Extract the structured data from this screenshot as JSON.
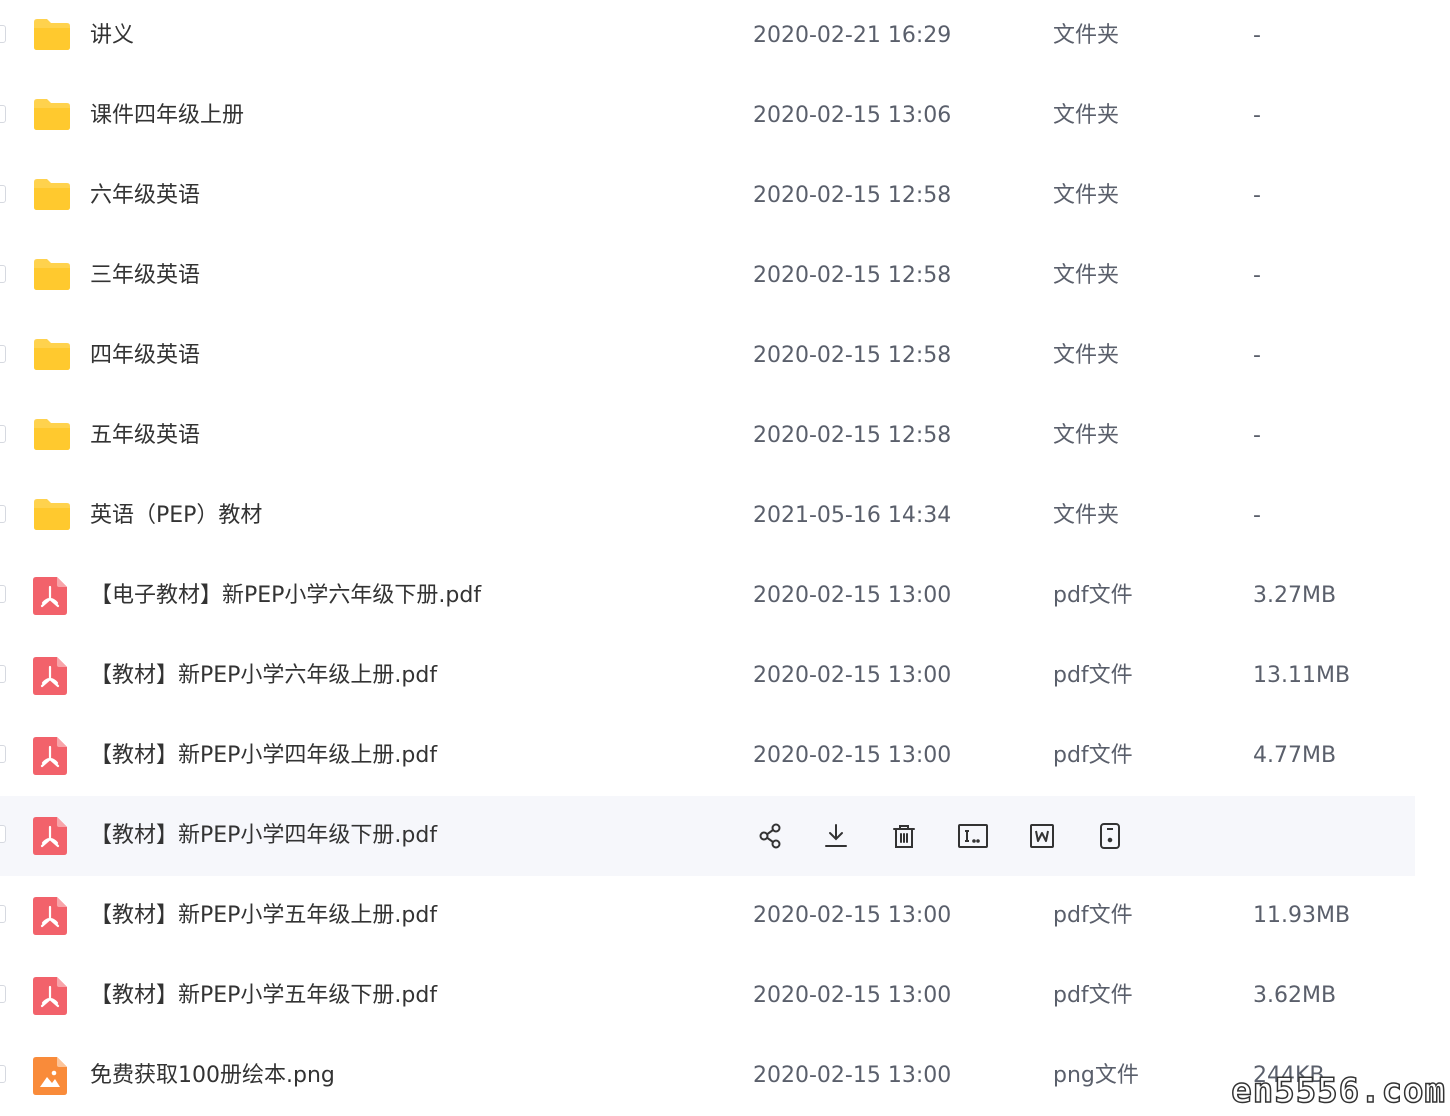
{
  "colors": {
    "folder": "#FFD24D",
    "pdf": "#F2626B",
    "png": "#F98B3A",
    "row_hover": "#f6f7fb"
  },
  "files": [
    {
      "name": "讲义",
      "date": "2020-02-21 16:29",
      "type": "文件夹",
      "size": "-",
      "icon": "folder-icon"
    },
    {
      "name": "课件四年级上册",
      "date": "2020-02-15 13:06",
      "type": "文件夹",
      "size": "-",
      "icon": "folder-icon"
    },
    {
      "name": "六年级英语",
      "date": "2020-02-15 12:58",
      "type": "文件夹",
      "size": "-",
      "icon": "folder-icon"
    },
    {
      "name": "三年级英语",
      "date": "2020-02-15 12:58",
      "type": "文件夹",
      "size": "-",
      "icon": "folder-icon"
    },
    {
      "name": "四年级英语",
      "date": "2020-02-15 12:58",
      "type": "文件夹",
      "size": "-",
      "icon": "folder-icon"
    },
    {
      "name": "五年级英语",
      "date": "2020-02-15 12:58",
      "type": "文件夹",
      "size": "-",
      "icon": "folder-icon"
    },
    {
      "name": "英语（PEP）教材",
      "date": "2021-05-16 14:34",
      "type": "文件夹",
      "size": "-",
      "icon": "folder-icon"
    },
    {
      "name": "【电子教材】新PEP小学六年级下册.pdf",
      "date": "2020-02-15 13:00",
      "type": "pdf文件",
      "size": "3.27MB",
      "icon": "pdf-file-icon"
    },
    {
      "name": "【教材】新PEP小学六年级上册.pdf",
      "date": "2020-02-15 13:00",
      "type": "pdf文件",
      "size": "13.11MB",
      "icon": "pdf-file-icon"
    },
    {
      "name": "【教材】新PEP小学四年级上册.pdf",
      "date": "2020-02-15 13:00",
      "type": "pdf文件",
      "size": "4.77MB",
      "icon": "pdf-file-icon"
    },
    {
      "name": "【教材】新PEP小学四年级下册.pdf",
      "date": "",
      "type": "",
      "size": "",
      "icon": "pdf-file-icon",
      "hovered": true
    },
    {
      "name": "【教材】新PEP小学五年级上册.pdf",
      "date": "2020-02-15 13:00",
      "type": "pdf文件",
      "size": "11.93MB",
      "icon": "pdf-file-icon"
    },
    {
      "name": "【教材】新PEP小学五年级下册.pdf",
      "date": "2020-02-15 13:00",
      "type": "pdf文件",
      "size": "3.62MB",
      "icon": "pdf-file-icon"
    },
    {
      "name": "免费获取100册绘本.png",
      "date": "2020-02-15 13:00",
      "type": "png文件",
      "size": "244KB",
      "icon": "image-file-icon"
    }
  ],
  "hover_actions": [
    "share-icon",
    "download-icon",
    "delete-icon",
    "rename-icon",
    "convert-word-icon",
    "more-doc-icon"
  ],
  "watermark": "en5556.com"
}
